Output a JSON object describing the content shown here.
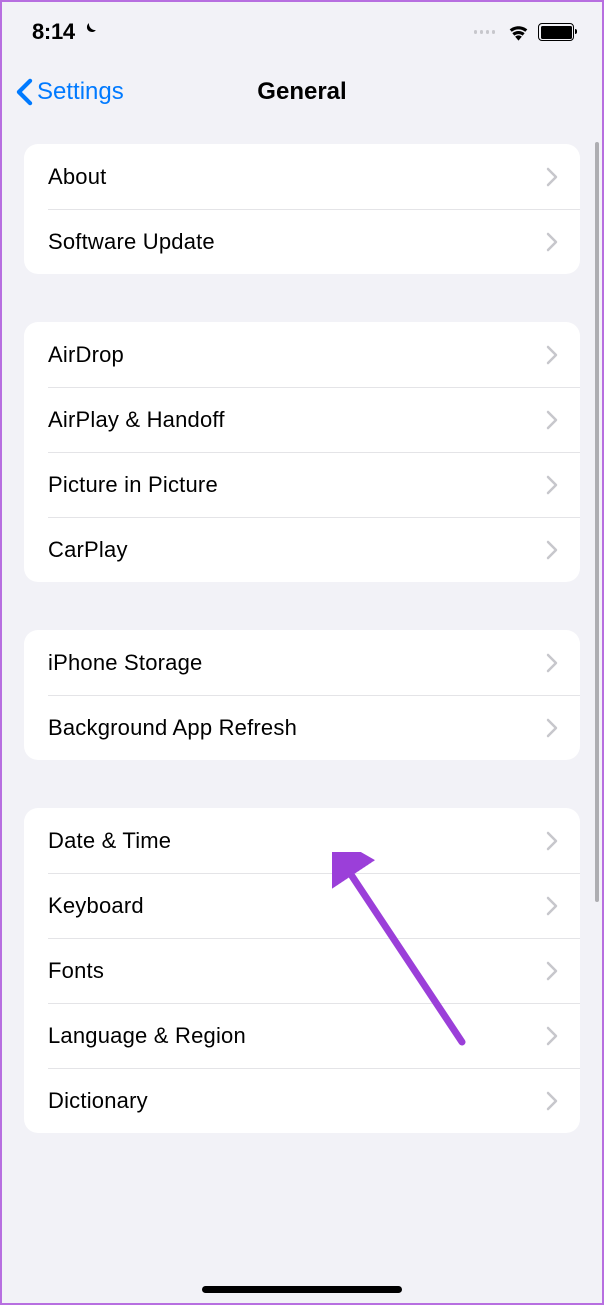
{
  "status": {
    "time": "8:14"
  },
  "nav": {
    "back_label": "Settings",
    "title": "General"
  },
  "groups": [
    {
      "items": [
        {
          "label": "About"
        },
        {
          "label": "Software Update"
        }
      ]
    },
    {
      "items": [
        {
          "label": "AirDrop"
        },
        {
          "label": "AirPlay & Handoff"
        },
        {
          "label": "Picture in Picture"
        },
        {
          "label": "CarPlay"
        }
      ]
    },
    {
      "items": [
        {
          "label": "iPhone Storage"
        },
        {
          "label": "Background App Refresh"
        }
      ]
    },
    {
      "items": [
        {
          "label": "Date & Time"
        },
        {
          "label": "Keyboard"
        },
        {
          "label": "Fonts"
        },
        {
          "label": "Language & Region"
        },
        {
          "label": "Dictionary"
        }
      ]
    }
  ],
  "annotation": {
    "arrow_color": "#9b3fd9"
  }
}
